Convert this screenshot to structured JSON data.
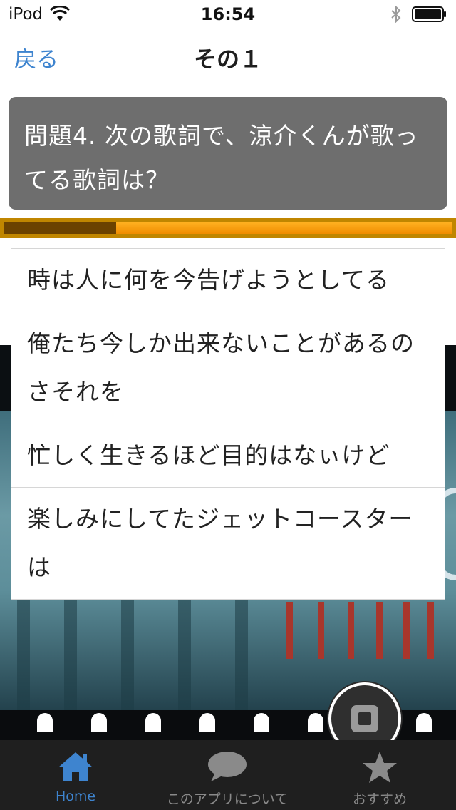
{
  "status_bar": {
    "carrier": "iPod",
    "time": "16:54",
    "icons": [
      "wifi-icon",
      "bluetooth-icon",
      "battery-icon"
    ]
  },
  "nav": {
    "back_label": "戻る",
    "title": "その１"
  },
  "question": {
    "text": "問題4. 次の歌詞で、涼介くんが歌ってる歌詞は？"
  },
  "progress": {
    "fraction": 0.25
  },
  "answers": [
    "時は人に何を今告げようとしてる",
    "俺たち今しか出来ないことがあるのさそれを",
    "忙しく生きるほど目的はなぃけど",
    "楽しみにしてたジェットコースターは"
  ],
  "float_button": {
    "icon": "stop-icon"
  },
  "tab_bar": {
    "items": [
      {
        "label": "Home",
        "icon": "home-icon",
        "active": true
      },
      {
        "label": "このアプリについて",
        "icon": "chat-bubble-icon",
        "active": false
      },
      {
        "label": "おすすめ",
        "icon": "star-icon",
        "active": false
      }
    ]
  },
  "colors": {
    "accent": "#3e84cf",
    "question_bg": "#6e6e6e",
    "progress_frame": "#c08600",
    "progress_track": "#f5a010",
    "progress_fill": "#6b4200",
    "tab_bar_bg": "#1f1f1f",
    "tab_active": "#3e84cf",
    "tab_inactive": "#8a8a8a"
  }
}
